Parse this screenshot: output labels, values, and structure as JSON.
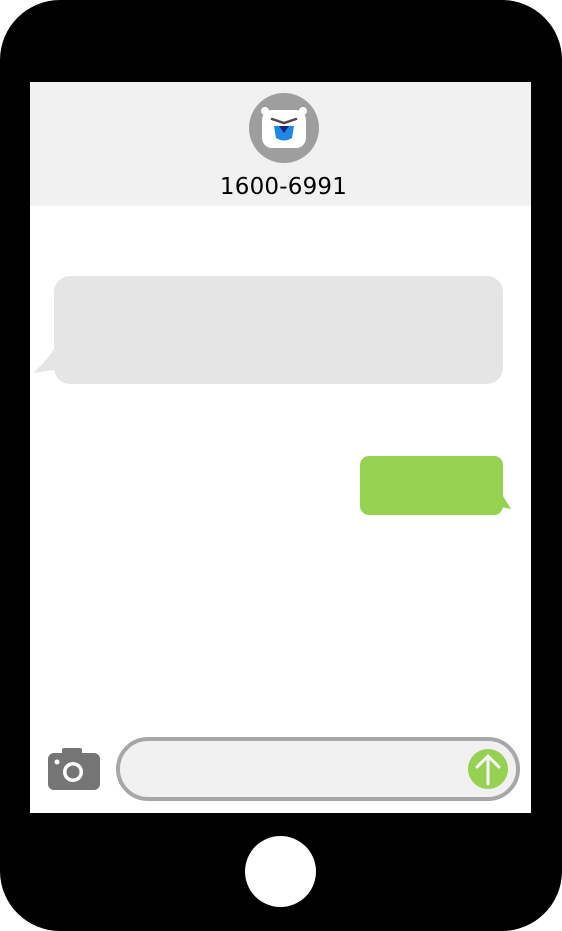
{
  "header": {
    "contact_name": "1600-6991",
    "avatar_icon": "polar-bear-icon"
  },
  "messages": [
    {
      "direction": "incoming",
      "text": ""
    },
    {
      "direction": "outgoing",
      "text": ""
    }
  ],
  "composer": {
    "camera_icon": "camera-icon",
    "input_value": "",
    "input_placeholder": "",
    "send_icon": "up-arrow-icon"
  },
  "colors": {
    "phone_frame": "#000000",
    "header_bg": "#f1f1f1",
    "incoming_bubble": "#e5e5e5",
    "outgoing_bubble": "#95d251",
    "send_button": "#95d251",
    "accent_blue": "#1e88e5"
  }
}
